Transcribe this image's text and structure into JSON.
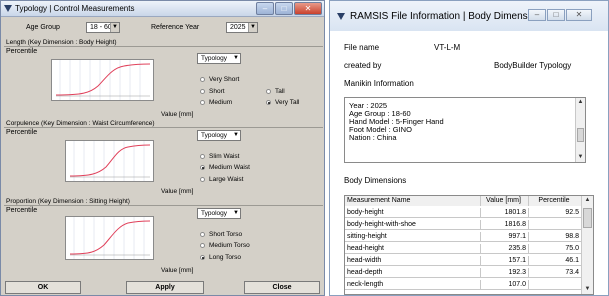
{
  "left_window": {
    "title": "Typology | Control Measurements",
    "window_buttons": {
      "minimize": "–",
      "maximize": "□",
      "close": "✕"
    },
    "age_group": {
      "label": "Age Group",
      "value": "18 - 60"
    },
    "reference_year": {
      "label": "Reference Year",
      "value": "2025"
    },
    "sections": [
      {
        "title": "Length (Key Dimension : Body Height)",
        "percentile_label": "Percentile",
        "typology_button": "Typology",
        "value_label": "Value [mm]",
        "options": [
          {
            "label": "Very Short",
            "checked": false
          },
          {
            "label": "Short",
            "checked": false
          },
          {
            "label": "Medium",
            "checked": false
          },
          {
            "label": "Tall",
            "checked": false
          },
          {
            "label": "Very Tall",
            "checked": true
          }
        ]
      },
      {
        "title": "Corpulence (Key Dimension : Waist Circumference)",
        "percentile_label": "Percentile",
        "typology_button": "Typology",
        "value_label": "Value [mm]",
        "options": [
          {
            "label": "Slim Waist",
            "checked": false
          },
          {
            "label": "Medium Waist",
            "checked": true
          },
          {
            "label": "Large Waist",
            "checked": false
          }
        ]
      },
      {
        "title": "Proportion (Key Dimension : Sitting Height)",
        "percentile_label": "Percentile",
        "typology_button": "Typology",
        "value_label": "Value [mm]",
        "options": [
          {
            "label": "Short Torso",
            "checked": false
          },
          {
            "label": "Medium Torso",
            "checked": false
          },
          {
            "label": "Long Torso",
            "checked": true
          }
        ]
      }
    ],
    "buttons": {
      "ok": "OK",
      "apply": "Apply",
      "close": "Close"
    },
    "curve_color": "#e0405a"
  },
  "right_window": {
    "title": "RAMSIS File Information | Body Dimensions",
    "window_buttons": {
      "minimize": "–",
      "maximize": "□",
      "close": "✕"
    },
    "file_name_label": "File name",
    "file_name_value": "VT-L-M",
    "created_by_label": "created by",
    "created_by_value": "BodyBuilder Typology",
    "manikin_info_label": "Manikin Information",
    "manikin_info_lines": [
      "Year : 2025",
      "Age Group : 18-60",
      "Hand Model : 5-Finger Hand",
      "Foot Model : GINO",
      "Nation : China"
    ],
    "body_dimensions_label": "Body Dimensions",
    "table": {
      "headers": [
        "Measurement Name",
        "Value [mm]",
        "Percentile"
      ],
      "rows": [
        [
          "body-height",
          "1801.8",
          "92.5"
        ],
        [
          "body-height-with-shoe",
          "1816.8",
          ""
        ],
        [
          "sitting-height",
          "997.1",
          "98.8"
        ],
        [
          "head-height",
          "235.8",
          "75.0"
        ],
        [
          "head-width",
          "157.1",
          "46.1"
        ],
        [
          "head-depth",
          "192.3",
          "73.4"
        ],
        [
          "neck-length",
          "107.0",
          ""
        ]
      ]
    }
  }
}
